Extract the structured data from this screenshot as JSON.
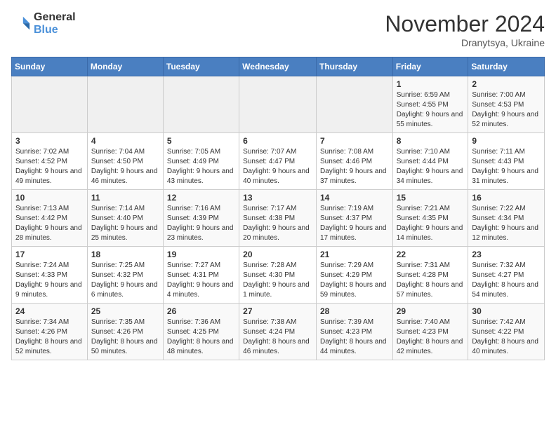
{
  "logo": {
    "general": "General",
    "blue": "Blue"
  },
  "title": "November 2024",
  "location": "Dranytsya, Ukraine",
  "weekdays": [
    "Sunday",
    "Monday",
    "Tuesday",
    "Wednesday",
    "Thursday",
    "Friday",
    "Saturday"
  ],
  "weeks": [
    [
      {
        "day": "",
        "sunrise": "",
        "sunset": "",
        "daylight": ""
      },
      {
        "day": "",
        "sunrise": "",
        "sunset": "",
        "daylight": ""
      },
      {
        "day": "",
        "sunrise": "",
        "sunset": "",
        "daylight": ""
      },
      {
        "day": "",
        "sunrise": "",
        "sunset": "",
        "daylight": ""
      },
      {
        "day": "",
        "sunrise": "",
        "sunset": "",
        "daylight": ""
      },
      {
        "day": "1",
        "sunrise": "Sunrise: 6:59 AM",
        "sunset": "Sunset: 4:55 PM",
        "daylight": "Daylight: 9 hours and 55 minutes."
      },
      {
        "day": "2",
        "sunrise": "Sunrise: 7:00 AM",
        "sunset": "Sunset: 4:53 PM",
        "daylight": "Daylight: 9 hours and 52 minutes."
      }
    ],
    [
      {
        "day": "3",
        "sunrise": "Sunrise: 7:02 AM",
        "sunset": "Sunset: 4:52 PM",
        "daylight": "Daylight: 9 hours and 49 minutes."
      },
      {
        "day": "4",
        "sunrise": "Sunrise: 7:04 AM",
        "sunset": "Sunset: 4:50 PM",
        "daylight": "Daylight: 9 hours and 46 minutes."
      },
      {
        "day": "5",
        "sunrise": "Sunrise: 7:05 AM",
        "sunset": "Sunset: 4:49 PM",
        "daylight": "Daylight: 9 hours and 43 minutes."
      },
      {
        "day": "6",
        "sunrise": "Sunrise: 7:07 AM",
        "sunset": "Sunset: 4:47 PM",
        "daylight": "Daylight: 9 hours and 40 minutes."
      },
      {
        "day": "7",
        "sunrise": "Sunrise: 7:08 AM",
        "sunset": "Sunset: 4:46 PM",
        "daylight": "Daylight: 9 hours and 37 minutes."
      },
      {
        "day": "8",
        "sunrise": "Sunrise: 7:10 AM",
        "sunset": "Sunset: 4:44 PM",
        "daylight": "Daylight: 9 hours and 34 minutes."
      },
      {
        "day": "9",
        "sunrise": "Sunrise: 7:11 AM",
        "sunset": "Sunset: 4:43 PM",
        "daylight": "Daylight: 9 hours and 31 minutes."
      }
    ],
    [
      {
        "day": "10",
        "sunrise": "Sunrise: 7:13 AM",
        "sunset": "Sunset: 4:42 PM",
        "daylight": "Daylight: 9 hours and 28 minutes."
      },
      {
        "day": "11",
        "sunrise": "Sunrise: 7:14 AM",
        "sunset": "Sunset: 4:40 PM",
        "daylight": "Daylight: 9 hours and 25 minutes."
      },
      {
        "day": "12",
        "sunrise": "Sunrise: 7:16 AM",
        "sunset": "Sunset: 4:39 PM",
        "daylight": "Daylight: 9 hours and 23 minutes."
      },
      {
        "day": "13",
        "sunrise": "Sunrise: 7:17 AM",
        "sunset": "Sunset: 4:38 PM",
        "daylight": "Daylight: 9 hours and 20 minutes."
      },
      {
        "day": "14",
        "sunrise": "Sunrise: 7:19 AM",
        "sunset": "Sunset: 4:37 PM",
        "daylight": "Daylight: 9 hours and 17 minutes."
      },
      {
        "day": "15",
        "sunrise": "Sunrise: 7:21 AM",
        "sunset": "Sunset: 4:35 PM",
        "daylight": "Daylight: 9 hours and 14 minutes."
      },
      {
        "day": "16",
        "sunrise": "Sunrise: 7:22 AM",
        "sunset": "Sunset: 4:34 PM",
        "daylight": "Daylight: 9 hours and 12 minutes."
      }
    ],
    [
      {
        "day": "17",
        "sunrise": "Sunrise: 7:24 AM",
        "sunset": "Sunset: 4:33 PM",
        "daylight": "Daylight: 9 hours and 9 minutes."
      },
      {
        "day": "18",
        "sunrise": "Sunrise: 7:25 AM",
        "sunset": "Sunset: 4:32 PM",
        "daylight": "Daylight: 9 hours and 6 minutes."
      },
      {
        "day": "19",
        "sunrise": "Sunrise: 7:27 AM",
        "sunset": "Sunset: 4:31 PM",
        "daylight": "Daylight: 9 hours and 4 minutes."
      },
      {
        "day": "20",
        "sunrise": "Sunrise: 7:28 AM",
        "sunset": "Sunset: 4:30 PM",
        "daylight": "Daylight: 9 hours and 1 minute."
      },
      {
        "day": "21",
        "sunrise": "Sunrise: 7:29 AM",
        "sunset": "Sunset: 4:29 PM",
        "daylight": "Daylight: 8 hours and 59 minutes."
      },
      {
        "day": "22",
        "sunrise": "Sunrise: 7:31 AM",
        "sunset": "Sunset: 4:28 PM",
        "daylight": "Daylight: 8 hours and 57 minutes."
      },
      {
        "day": "23",
        "sunrise": "Sunrise: 7:32 AM",
        "sunset": "Sunset: 4:27 PM",
        "daylight": "Daylight: 8 hours and 54 minutes."
      }
    ],
    [
      {
        "day": "24",
        "sunrise": "Sunrise: 7:34 AM",
        "sunset": "Sunset: 4:26 PM",
        "daylight": "Daylight: 8 hours and 52 minutes."
      },
      {
        "day": "25",
        "sunrise": "Sunrise: 7:35 AM",
        "sunset": "Sunset: 4:26 PM",
        "daylight": "Daylight: 8 hours and 50 minutes."
      },
      {
        "day": "26",
        "sunrise": "Sunrise: 7:36 AM",
        "sunset": "Sunset: 4:25 PM",
        "daylight": "Daylight: 8 hours and 48 minutes."
      },
      {
        "day": "27",
        "sunrise": "Sunrise: 7:38 AM",
        "sunset": "Sunset: 4:24 PM",
        "daylight": "Daylight: 8 hours and 46 minutes."
      },
      {
        "day": "28",
        "sunrise": "Sunrise: 7:39 AM",
        "sunset": "Sunset: 4:23 PM",
        "daylight": "Daylight: 8 hours and 44 minutes."
      },
      {
        "day": "29",
        "sunrise": "Sunrise: 7:40 AM",
        "sunset": "Sunset: 4:23 PM",
        "daylight": "Daylight: 8 hours and 42 minutes."
      },
      {
        "day": "30",
        "sunrise": "Sunrise: 7:42 AM",
        "sunset": "Sunset: 4:22 PM",
        "daylight": "Daylight: 8 hours and 40 minutes."
      }
    ]
  ]
}
